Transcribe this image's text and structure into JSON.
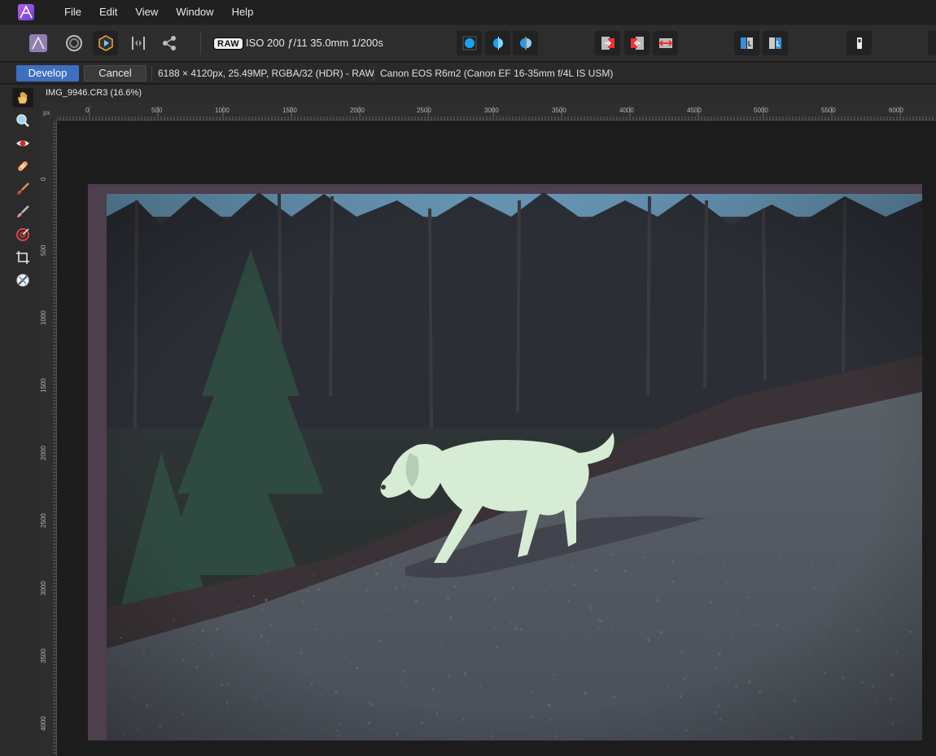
{
  "menu": {
    "items": [
      "File",
      "Edit",
      "View",
      "Window",
      "Help"
    ]
  },
  "toolbar": {
    "raw_badge": "RAW",
    "exif": "ISO 200 ƒ/11 35.0mm 1/200s",
    "icons": [
      "photo-persona-icon",
      "liquify-persona-icon",
      "develop-persona-icon",
      "tone-mapping-persona-icon",
      "export-persona-icon",
      "view-full-icon",
      "view-split-icon",
      "view-mirror-icon",
      "before-after-icon",
      "swap-icon",
      "compare-icon",
      "assistant-icon",
      "output-icon",
      "overlay-icon"
    ]
  },
  "context": {
    "develop_label": "Develop",
    "cancel_label": "Cancel",
    "image_info": "6188 × 4120px, 25.49MP, RGBA/32 (HDR) - RAW",
    "camera_info": "Canon EOS R6m2 (Canon EF 16-35mm f/4L IS USM)"
  },
  "document": {
    "tab_title": "IMG_9946.CR3 (16.6%)"
  },
  "ruler": {
    "unit": "px",
    "top_labels": [
      "0",
      "500",
      "1000",
      "1500",
      "2000",
      "2500",
      "3000",
      "3500",
      "4000",
      "4500",
      "5000",
      "5500",
      "6000"
    ],
    "left_labels": [
      "0",
      "500",
      "1000",
      "1500",
      "2000",
      "2500",
      "3000",
      "3500",
      "4000"
    ]
  },
  "tools": [
    "hand-tool-icon",
    "zoom-tool-icon",
    "red-eye-tool-icon",
    "blemish-tool-icon",
    "brush-tool-icon",
    "erase-brush-tool-icon",
    "gradient-tool-icon",
    "crop-tool-icon",
    "white-balance-picker-icon"
  ],
  "colors": {
    "accent": "#3e6fc1",
    "background": "#1e1e1e",
    "panel": "#2d2d2d"
  }
}
